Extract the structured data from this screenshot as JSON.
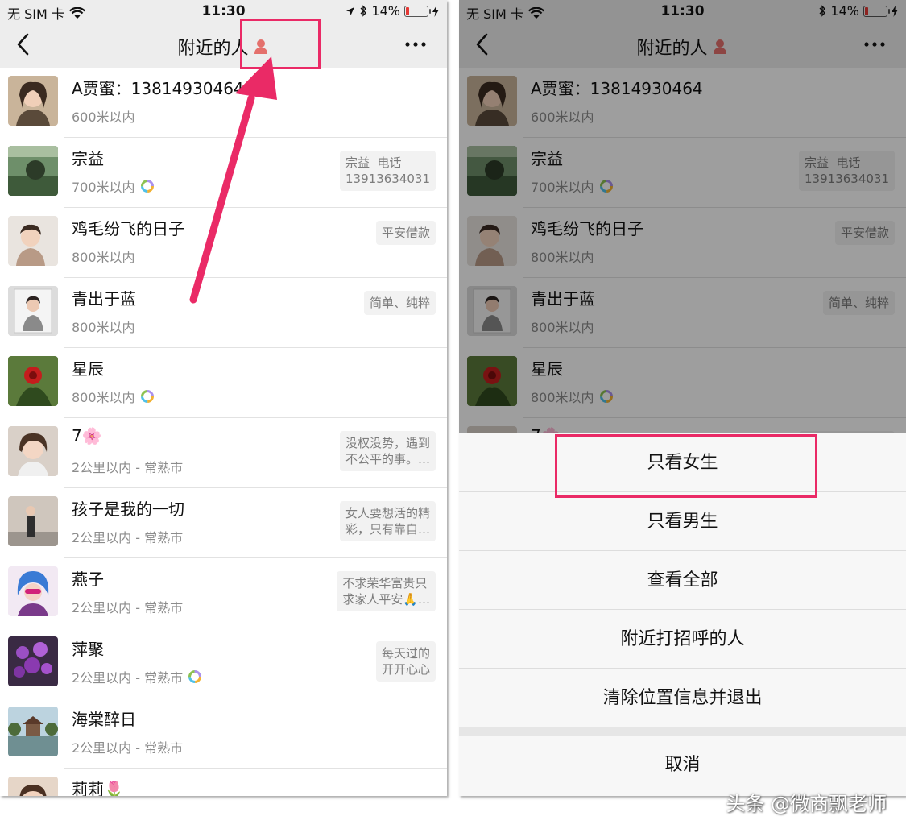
{
  "status": {
    "carrier": "无 SIM 卡",
    "time": "11:30",
    "battery": "14%",
    "battery_level": 0.14,
    "battery_color": "#e53935"
  },
  "nav": {
    "title": "附近的人"
  },
  "people": [
    {
      "name": "A贾蜜：13814930464",
      "distance": "600米以内",
      "moments": false,
      "signature": "",
      "avatar": "woman-portrait"
    },
    {
      "name": "宗益",
      "distance": "700米以内",
      "moments": true,
      "signature": "宗益  电话\n13913634031",
      "avatar": "landscape-photo"
    },
    {
      "name": "鸡毛纷飞的日子",
      "distance": "800米以内",
      "moments": false,
      "signature": "平安借款",
      "avatar": "child-photo"
    },
    {
      "name": "青出于蓝",
      "distance": "800米以内",
      "moments": false,
      "signature": "简单、纯粹",
      "avatar": "framed-girl-photo"
    },
    {
      "name": "星辰",
      "distance": "800米以内",
      "moments": true,
      "signature": "",
      "avatar": "red-flower-photo"
    },
    {
      "name": "7🌸",
      "distance": "2公里以内 - 常熟市",
      "moments": false,
      "signature": "没权没势，遇到\n不公平的事。…",
      "avatar": "woman-selfie"
    },
    {
      "name": "孩子是我的一切",
      "distance": "2公里以内 - 常熟市",
      "moments": false,
      "signature": "女人要想活的精\n彩，只有靠自…",
      "avatar": "street-photo"
    },
    {
      "name": "燕子",
      "distance": "2公里以内 - 常熟市",
      "moments": false,
      "signature": "不求荣华富贵只\n求家人平安🙏…",
      "avatar": "blue-hair-woman"
    },
    {
      "name": "萍聚",
      "distance": "2公里以内 - 常熟市",
      "moments": true,
      "signature": "每天过的\n开开心心",
      "avatar": "purple-flowers"
    },
    {
      "name": "海棠醉日",
      "distance": "2公里以内 - 常熟市",
      "moments": false,
      "signature": "",
      "avatar": "lake-pavilion"
    },
    {
      "name": "莉莉🌷",
      "distance": "",
      "moments": false,
      "signature": "",
      "avatar": "woman-portrait-2"
    }
  ],
  "action_sheet": {
    "options": [
      "只看女生",
      "只看男生",
      "查看全部",
      "附近打招呼的人",
      "清除位置信息并退出"
    ],
    "cancel": "取消"
  },
  "annotation": {
    "highlight_color": "#ea2a66"
  },
  "watermark": "头条 @微商飘老师"
}
